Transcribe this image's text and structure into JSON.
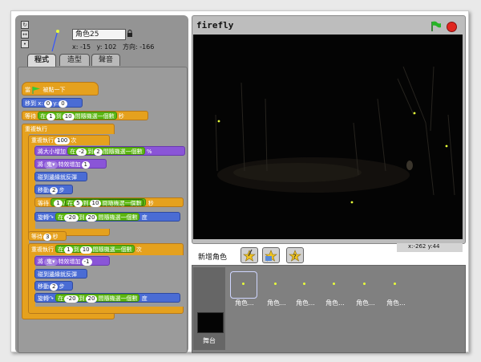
{
  "sprite": {
    "name": "角色25",
    "coords": "x: -15   y: 102   方向: -166"
  },
  "tabs": [
    {
      "label": "程式",
      "active": true
    },
    {
      "label": "造型",
      "active": false
    },
    {
      "label": "聲音",
      "active": false
    }
  ],
  "script": {
    "hat": {
      "label": "當",
      "suffix": "被點一下"
    },
    "goto": {
      "label": "移到 x:",
      "x": "0",
      "y_label": "y:",
      "y": "0"
    },
    "wait1": {
      "label": "等待",
      "pre": "在",
      "a": "1",
      "mid": "到",
      "b": "10",
      "suffix": "間隨機選一個數",
      "unit": "秒"
    },
    "forever": {
      "label": "重複執行"
    },
    "repeat1": {
      "label": "重複執行",
      "n": "100",
      "unit": "次"
    },
    "size": {
      "label": "將大小增加",
      "pre": "在",
      "a": "-2",
      "mid": "到",
      "b": "2",
      "suffix": "間隨機選一個數",
      "unit": "%"
    },
    "effect1": {
      "label": "將",
      "effect": "鬼",
      "mid": "特效增加",
      "n": "1"
    },
    "bounce1": {
      "label": "碰到邊緣就反彈"
    },
    "move1": {
      "label": "移動",
      "n": "2",
      "unit": "步"
    },
    "wait2": {
      "label": "等待",
      "a": "1",
      "op": "/",
      "pre": "在",
      "b": "5",
      "mid": "到",
      "c": "10",
      "suffix": "間隨機選一個數",
      "unit": "秒"
    },
    "turn1": {
      "label": "旋轉",
      "pre": "在",
      "a": "-20",
      "mid": "到",
      "b": "20",
      "suffix": "間隨機選一個數",
      "unit": "度"
    },
    "wait3": {
      "label": "等待",
      "n": "3",
      "unit": "秒"
    },
    "repeat2": {
      "label": "重複執行",
      "pre": "在",
      "a": "1",
      "mid": "到",
      "b": "10",
      "suffix": "間隨機選一個數",
      "unit": "次"
    },
    "effect2": {
      "label": "將",
      "effect": "鬼",
      "mid": "特效增加",
      "n": "-1"
    },
    "bounce2": {
      "label": "碰到邊緣就反彈"
    },
    "move2": {
      "label": "移動",
      "n": "2",
      "unit": "步"
    },
    "turn2": {
      "label": "旋轉",
      "pre": "在",
      "a": "-20",
      "mid": "到",
      "b": "20",
      "suffix": "間隨機選一個數",
      "unit": "度"
    }
  },
  "stage": {
    "title": "firefly",
    "mouse": "x:-262  y:44"
  },
  "sprites_panel": {
    "label": "新增角色",
    "stage_label": "舞台",
    "items": [
      "角色...",
      "角色...",
      "角色...",
      "角色...",
      "角色...",
      "角色..."
    ]
  }
}
